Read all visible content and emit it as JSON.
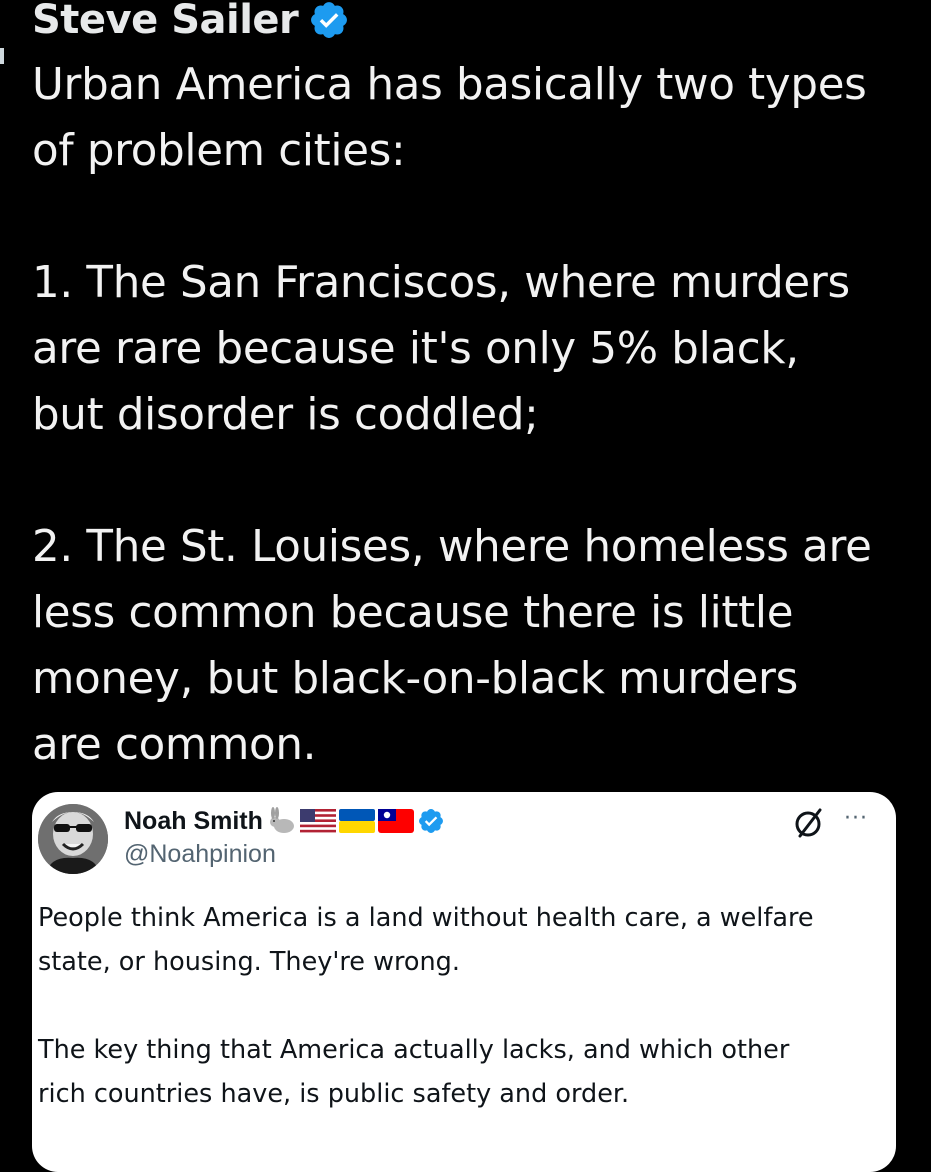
{
  "tweet": {
    "author_name": "Steve Sailer",
    "verified_icon": "verified-badge-icon",
    "text_lines": [
      "Urban America has basically two types",
      "of problem cities:",
      "",
      "1. The San Franciscos, where murders",
      "are rare because it's only 5% black,",
      "but disorder is coddled;",
      "",
      "2. The St. Louises, where homeless are",
      "less common because there is little",
      "money, but black-on-black murders",
      "are common."
    ]
  },
  "quote": {
    "author_name": "Noah Smith",
    "emoji_icons": [
      "rabbit-icon",
      "us-flag-icon",
      "ukraine-flag-icon",
      "taiwan-flag-icon"
    ],
    "verified_icon": "verified-badge-icon",
    "handle": "@Noahpinion",
    "more_label": "···",
    "text_lines": [
      "People think America is a land without health care, a welfare",
      "state, or housing. They're wrong.",
      "",
      "The key thing that America actually lacks, and which other",
      "rich countries have, is public safety and order."
    ]
  },
  "colors": {
    "background": "#000000",
    "text_primary": "#e7e9ea",
    "verified_blue": "#1d9bf0",
    "card_background": "#ffffff",
    "card_text": "#0f1419",
    "handle_gray": "#536471"
  }
}
